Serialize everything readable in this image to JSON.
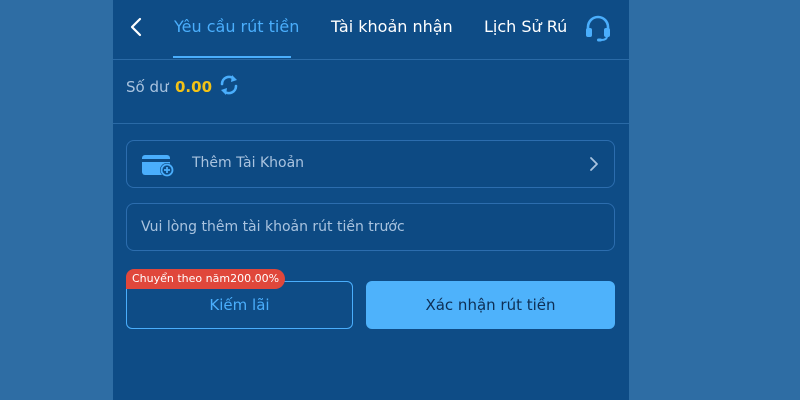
{
  "header": {
    "tabs": [
      {
        "label": "Yêu cầu rút tiền",
        "active": true
      },
      {
        "label": "Tài khoản nhận",
        "active": false
      },
      {
        "label": "Lịch Sử Rú",
        "active": false
      }
    ],
    "back_icon": "chevron-left-icon",
    "support_icon": "headset-icon"
  },
  "balance": {
    "label": "Số dư",
    "value": "0.00",
    "refresh_icon": "refresh-icon"
  },
  "add_account": {
    "label": "Thêm Tài Khoản",
    "icon": "wallet-add-icon"
  },
  "notice": {
    "text": "Vui lòng thêm tài khoản rút tiền trước"
  },
  "actions": {
    "badge": "Chuyển theo năm200.00%",
    "earn_label": "Kiếm lãi",
    "confirm_label": "Xác nhận rút tiền"
  },
  "colors": {
    "accent": "#4aaefc",
    "balance": "#f2c216",
    "badge": "#e0473b",
    "panel": "#0e4c86",
    "background": "#2e6da4"
  }
}
